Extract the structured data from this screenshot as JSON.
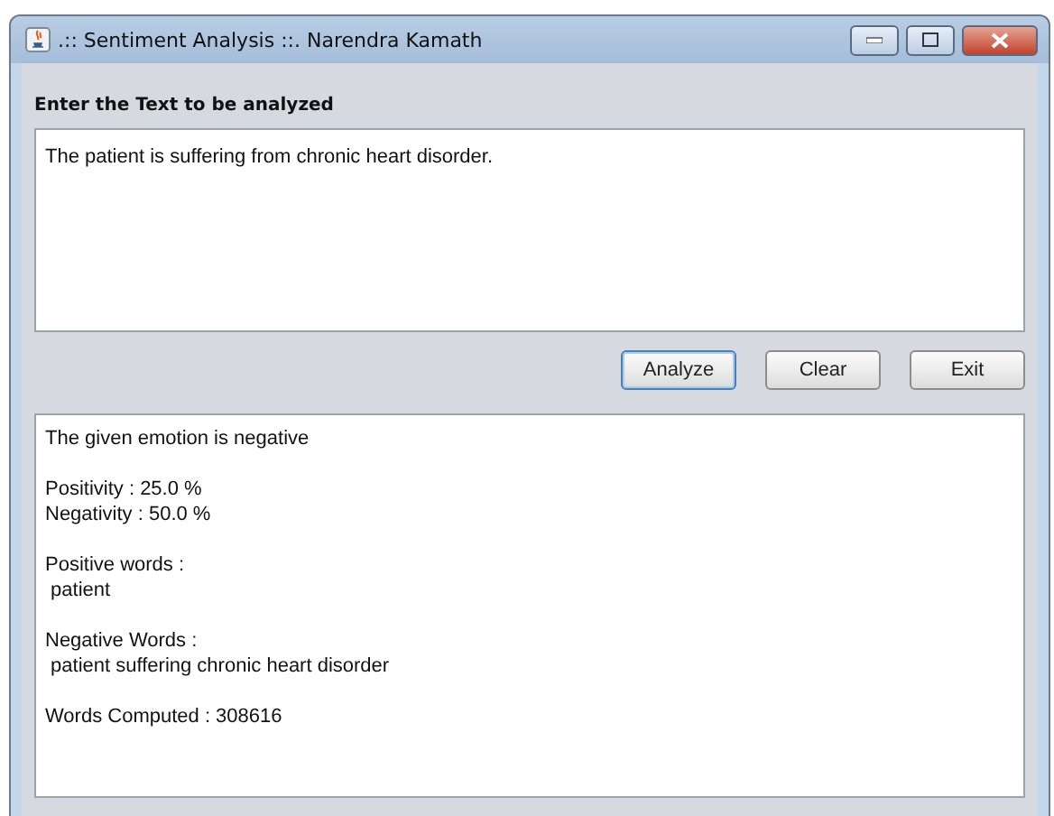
{
  "window": {
    "title": ".:: Sentiment Analysis ::. Narendra Kamath"
  },
  "input_label": "Enter the Text to be analyzed",
  "input_text": "The patient is suffering from chronic heart disorder.",
  "buttons": [
    {
      "label": "Analyze",
      "focused": true
    },
    {
      "label": "Clear",
      "focused": false
    },
    {
      "label": "Exit",
      "focused": false
    }
  ],
  "output_paragraphs": [
    [
      "The given emotion is negative"
    ],
    [
      "Positivity : 25.0 %",
      "Negativity : 50.0 %"
    ],
    [
      "Positive words :",
      " patient"
    ],
    [
      "Negative Words :",
      " patient suffering chronic heart disorder"
    ],
    [
      "Words Computed : 308616"
    ]
  ]
}
